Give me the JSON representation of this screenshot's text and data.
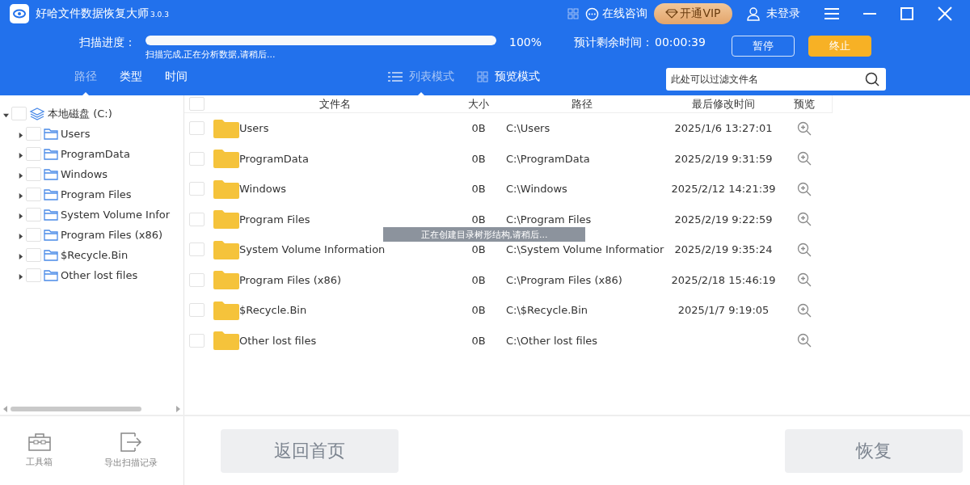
{
  "window": {
    "title": "好哈文件数据恢复大师",
    "version": "3.0.3"
  },
  "title_bar": {
    "consult": "在线咨询",
    "vip": "开通VIP",
    "login": "未登录"
  },
  "scan": {
    "label": "扫描进度：",
    "level": 1,
    "percent": "100%",
    "status": "扫描完成,正在分析数据,请稍后...",
    "remaining_label": "预计剩余时间：",
    "remaining": "00:00:39",
    "pause": "暂停",
    "stop": "终止"
  },
  "tabs": [
    {
      "label": "路径",
      "selected": true
    },
    {
      "label": "类型",
      "selected": false
    },
    {
      "label": "时间",
      "selected": false
    }
  ],
  "view_modes": [
    {
      "label": "列表模式",
      "kind": "list",
      "selected": true
    },
    {
      "label": "预览模式",
      "kind": "grid",
      "selected": false
    }
  ],
  "search": {
    "placeholder": "此处可以过滤文件名"
  },
  "tree": {
    "label": "本地磁盘 (C:)",
    "expanded": true,
    "checked": false,
    "children": [
      {
        "label": "Users",
        "expanded": false,
        "checked": false
      },
      {
        "label": "ProgramData",
        "expanded": false,
        "checked": false
      },
      {
        "label": "Windows",
        "expanded": false,
        "checked": false
      },
      {
        "label": "Program Files",
        "expanded": false,
        "checked": false
      },
      {
        "label": "System Volume Infor",
        "expanded": false,
        "checked": false
      },
      {
        "label": "Program Files (x86)",
        "expanded": false,
        "checked": false
      },
      {
        "label": "$Recycle.Bin",
        "expanded": false,
        "checked": false
      },
      {
        "label": "Other lost files",
        "expanded": false,
        "checked": false
      }
    ]
  },
  "table": {
    "select_all": {
      "checked": false
    },
    "columns": [
      "文件名",
      "大小",
      "路径",
      "最后修改时间",
      "预览"
    ],
    "rows": [
      {
        "name": "Users",
        "size": "0B",
        "path": "C:\\Users",
        "modified": "2025/1/6 13:27:01",
        "checked": false
      },
      {
        "name": "ProgramData",
        "size": "0B",
        "path": "C:\\ProgramData",
        "modified": "2025/2/19 9:31:59",
        "checked": false
      },
      {
        "name": "Windows",
        "size": "0B",
        "path": "C:\\Windows",
        "modified": "2025/2/12 14:21:39",
        "checked": false
      },
      {
        "name": "Program Files",
        "size": "0B",
        "path": "C:\\Program Files",
        "modified": "2025/2/19 9:22:59",
        "checked": false
      },
      {
        "name": "System Volume Information",
        "size": "0B",
        "path": "C:\\System Volume Informatior",
        "modified": "2025/2/19 9:35:24",
        "checked": false
      },
      {
        "name": "Program Files (x86)",
        "size": "0B",
        "path": "C:\\Program Files (x86)",
        "modified": "2025/2/18 15:46:19",
        "checked": false
      },
      {
        "name": "$Recycle.Bin",
        "size": "0B",
        "path": "C:\\$Recycle.Bin",
        "modified": "2025/1/7 9:19:05",
        "checked": false
      },
      {
        "name": "Other lost files",
        "size": "0B",
        "path": "C:\\Other lost files",
        "checked": false
      }
    ]
  },
  "toast": "正在创建目录树形结构,请稍后...",
  "sidebar_tools": [
    {
      "label": "工具箱",
      "kind": "toolbox"
    },
    {
      "label": "导出扫描记录",
      "kind": "export"
    }
  ],
  "buttons": {
    "home": "返回首页",
    "recover": "恢复"
  }
}
